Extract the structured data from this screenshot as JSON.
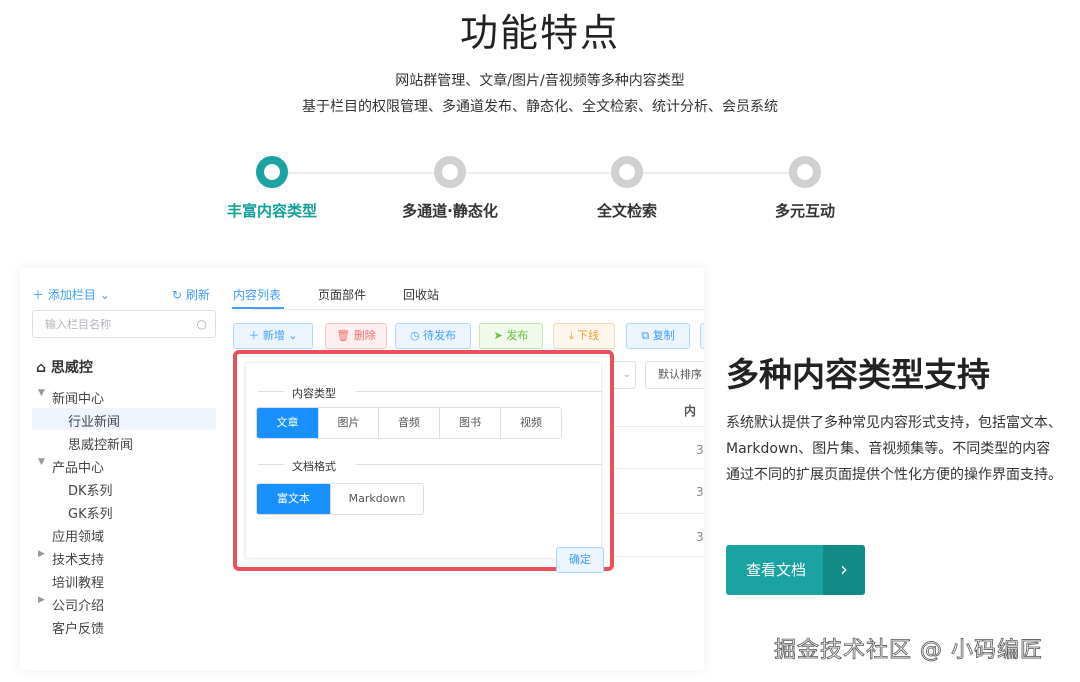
{
  "header": {
    "title": "功能特点",
    "subtitle_line1": "网站群管理、文章/图片/音视频等多种内容类型",
    "subtitle_line2": "基于栏目的权限管理、多通道发布、静态化、全文检索、统计分析、会员系统"
  },
  "steps": [
    {
      "label": "丰富内容类型",
      "active": true
    },
    {
      "label": "多通道·静态化",
      "active": false
    },
    {
      "label": "全文检索",
      "active": false
    },
    {
      "label": "多元互动",
      "active": false
    }
  ],
  "app": {
    "add_column": "添加栏目",
    "refresh": "刷新",
    "search_placeholder": "输入栏目名称",
    "tree_root": "思威控",
    "tree": [
      {
        "label": "新闻中心",
        "has_arrow": true
      },
      {
        "label": "行业新闻",
        "has_arrow": false
      },
      {
        "label": "思威控新闻",
        "has_arrow": false
      },
      {
        "label": "产品中心",
        "has_arrow": true
      },
      {
        "label": "DK系列",
        "has_arrow": false
      },
      {
        "label": "GK系列",
        "has_arrow": false
      },
      {
        "label": "应用领域",
        "has_arrow": false
      },
      {
        "label": "技术支持",
        "has_arrow": true
      },
      {
        "label": "培训教程",
        "has_arrow": false
      },
      {
        "label": "公司介绍",
        "has_arrow": true
      },
      {
        "label": "客户反馈",
        "has_arrow": false
      }
    ],
    "tabs": [
      "内容列表",
      "页面部件",
      "回收站"
    ],
    "toolbar": [
      "新增",
      "删除",
      "待发布",
      "发布",
      "下线",
      "复制"
    ],
    "sort_label": "默认排序",
    "column_header": "内",
    "row_values": [
      "3",
      "3",
      "3"
    ]
  },
  "dialog": {
    "content_type_title": "内容类型",
    "content_types": [
      "文章",
      "图片",
      "音频",
      "图书",
      "视频"
    ],
    "content_type_selected": "文章",
    "doc_format_title": "文档格式",
    "doc_formats": [
      "富文本",
      "Markdown"
    ],
    "doc_format_selected": "富文本",
    "confirm": "确定"
  },
  "feature": {
    "title": "多种内容类型支持",
    "description": "系统默认提供了多种常见内容形式支持，包括富文本、Markdown、图片集、音视频集等。不同类型的内容通过不同的扩展页面提供个性化方便的操作界面支持。",
    "button": "查看文档"
  },
  "watermark": "掘金技术社区 @ 小码编匠",
  "colors": {
    "accent": "#1aa3a0",
    "link": "#409eff",
    "highlight_border": "#e8505b"
  }
}
